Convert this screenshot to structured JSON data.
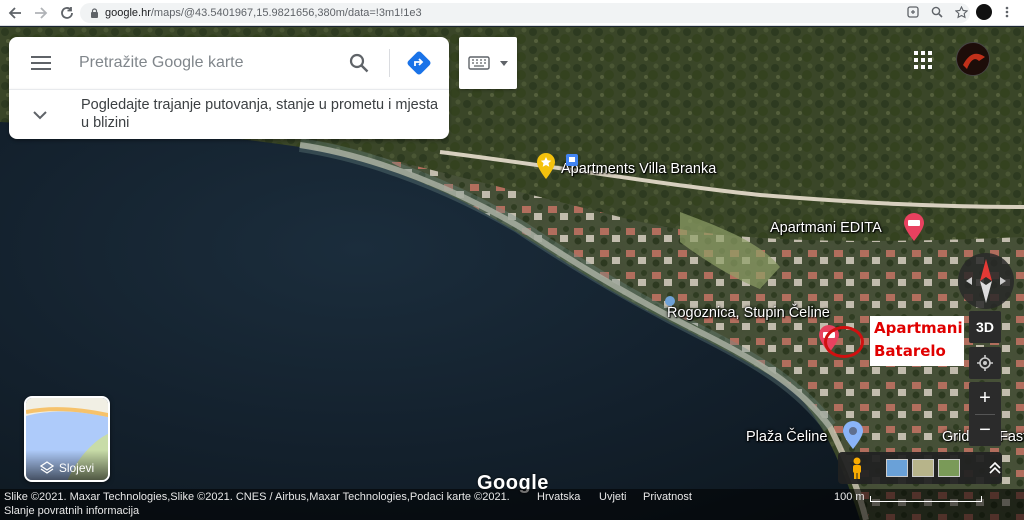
{
  "browser": {
    "url_main": "google.hr",
    "url_rest": "/maps/@43.5401967,15.9821656,380m/data=!3m1!1e3"
  },
  "search": {
    "placeholder": "Pretražite Google karte",
    "info_text": "Pogledajte trajanje putovanja, stanje u prometu i mjesta u blizini"
  },
  "map_labels": {
    "villa_branka": "Apartments Villa Branka",
    "edita": "Apartmani EDITA",
    "rogoznica": "Rogoznica, Stupin Čeline",
    "plaza": "Plaža Čeline",
    "grid": "Grid",
    "fast": "Fast"
  },
  "annotation": {
    "line1": "Apartmani",
    "line2": "Batarelo",
    "color": "#e00000"
  },
  "controls": {
    "three_d": "3D",
    "zoom_in": "+",
    "zoom_out": "−",
    "layers_label": "Slojevi"
  },
  "footer": {
    "attribution": "Slike ©2021. Maxar Technologies,Slike ©2021. CNES / Airbus,Maxar Technologies,Podaci karte ©2021.",
    "country": "Hrvatska",
    "terms": "Uvjeti",
    "privacy": "Privatnost",
    "feedback": "Slanje povratnih informacija",
    "scale": "100 m",
    "google": "Google"
  },
  "colors": {
    "sea": "#142230",
    "land": "#3b4a2a",
    "pin_red": "#e8415f",
    "pin_yellow": "#f4c20d",
    "accent_blue": "#4285f4"
  }
}
